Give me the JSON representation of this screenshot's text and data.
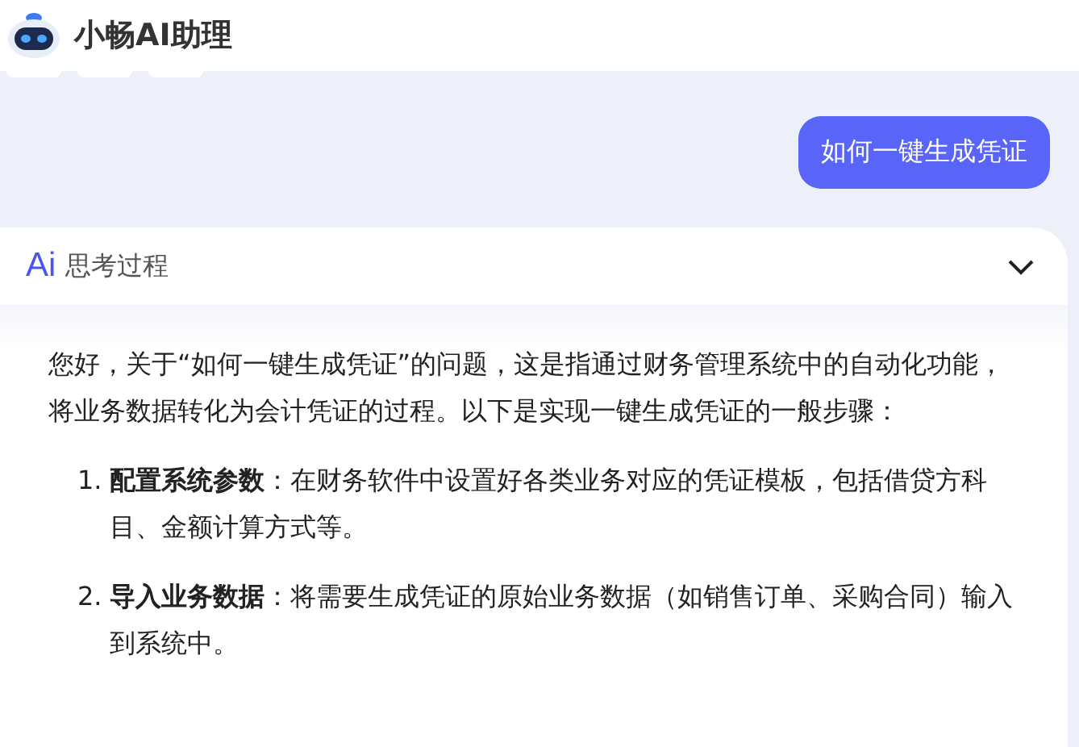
{
  "header": {
    "title": "小畅AI助理"
  },
  "user_message": {
    "text": "如何一键生成凭证"
  },
  "answer": {
    "thinking": {
      "icon_text": "Ai",
      "label": "思考过程",
      "expanded": false
    },
    "intro": "您好，关于“如何一键生成凭证”的问题，这是指通过财务管理系统中的自动化功能，将业务数据转化为会计凭证的过程。以下是实现一键生成凭证的一般步骤：",
    "steps": [
      {
        "number": "1.",
        "text": "**配置系统参数**：在财务软件中设置好各类业务对应的凭证模板，包括借贷方科目、金额计算方式等。"
      },
      {
        "number": "2.",
        "text": "**导入业务数据**：将需要生成凭证的原始业务数据（如销售订单、采购合同）输入到系统中。"
      }
    ]
  }
}
